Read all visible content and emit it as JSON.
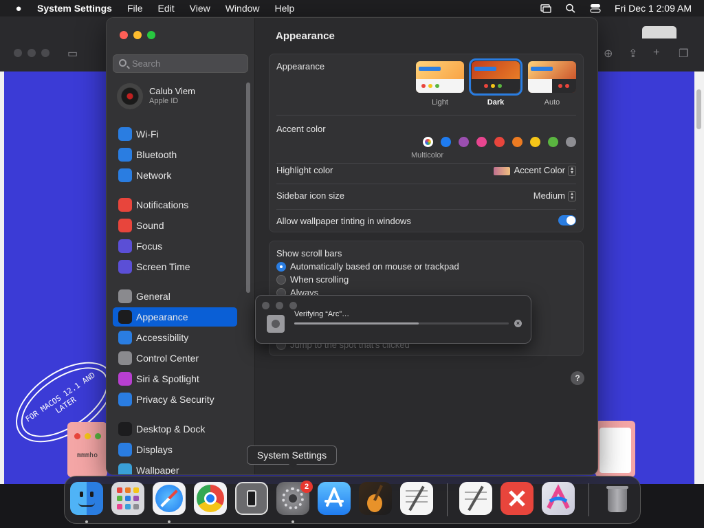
{
  "menubar": {
    "app": "System Settings",
    "items": [
      "File",
      "Edit",
      "View",
      "Window",
      "Help"
    ],
    "clock": "Fri Dec 1  2:09 AM"
  },
  "wallpaper": {
    "oval_text": "FOR MACOS 12.1 AND LATER",
    "card_text": "mmmho"
  },
  "sidebar": {
    "search_placeholder": "Search",
    "profile": {
      "name": "Calub Viem",
      "sub": "Apple ID"
    },
    "items": [
      {
        "label": "Wi-Fi",
        "icon": "wifi-icon",
        "color": "#2a7de1"
      },
      {
        "label": "Bluetooth",
        "icon": "bluetooth-icon",
        "color": "#2a7de1"
      },
      {
        "label": "Network",
        "icon": "network-icon",
        "color": "#2a7de1"
      },
      {
        "label": "Notifications",
        "icon": "bell-icon",
        "color": "#e8453c"
      },
      {
        "label": "Sound",
        "icon": "speaker-icon",
        "color": "#e8453c"
      },
      {
        "label": "Focus",
        "icon": "moon-icon",
        "color": "#5b4fd6"
      },
      {
        "label": "Screen Time",
        "icon": "hourglass-icon",
        "color": "#5b4fd6"
      },
      {
        "label": "General",
        "icon": "gear-icon",
        "color": "#8a8a8e"
      },
      {
        "label": "Appearance",
        "icon": "appearance-icon",
        "color": "#1c1c1e"
      },
      {
        "label": "Accessibility",
        "icon": "accessibility-icon",
        "color": "#2a7de1"
      },
      {
        "label": "Control Center",
        "icon": "toggle-icon",
        "color": "#8a8a8e"
      },
      {
        "label": "Siri & Spotlight",
        "icon": "siri-icon",
        "color": "#b83fd0"
      },
      {
        "label": "Privacy & Security",
        "icon": "hand-icon",
        "color": "#2a7de1"
      },
      {
        "label": "Desktop & Dock",
        "icon": "dock-icon",
        "color": "#1c1c1e"
      },
      {
        "label": "Displays",
        "icon": "display-icon",
        "color": "#2a7de1"
      },
      {
        "label": "Wallpaper",
        "icon": "wallpaper-icon",
        "color": "#3aa0d8"
      }
    ],
    "active": "Appearance"
  },
  "content": {
    "title": "Appearance",
    "appearance_label": "Appearance",
    "modes": [
      "Light",
      "Dark",
      "Auto"
    ],
    "selected_mode": "Dark",
    "accent_label": "Accent color",
    "accent_colors": [
      "#ffffff",
      "#1f7cf0",
      "#9b4fb0",
      "#e8458f",
      "#e8453c",
      "#ec7b22",
      "#f5c518",
      "#5ab540",
      "#8e8e93"
    ],
    "accent_multicolor_label": "Multicolor",
    "highlight_label": "Highlight color",
    "highlight_value": "Accent Color",
    "sidebar_icon_label": "Sidebar icon size",
    "sidebar_icon_value": "Medium",
    "tinting_label": "Allow wallpaper tinting in windows",
    "tinting_on": true,
    "scroll_label": "Show scroll bars",
    "scroll_options": [
      "Automatically based on mouse or trackpad",
      "When scrolling",
      "Always"
    ],
    "scroll_selected": 0,
    "click_option_partial": "Jump to the spot that's clicked",
    "help": "?"
  },
  "verify_dialog": {
    "text": "Verifying “Arc”…",
    "progress": 0.58
  },
  "tooltip": "System Settings",
  "dock": {
    "badge": "2"
  }
}
